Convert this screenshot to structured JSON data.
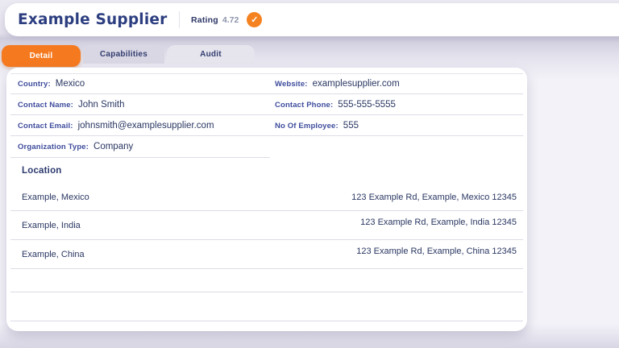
{
  "header": {
    "title": "Example Supplier",
    "rating_label": "Rating",
    "rating_value": "4.72",
    "badge_icon": "check",
    "accent_color": "#f58220"
  },
  "tabs": [
    {
      "label": "Detail",
      "active": true
    },
    {
      "label": "Capabilities",
      "active": false
    },
    {
      "label": "Audit",
      "active": false
    }
  ],
  "detail": {
    "fields": [
      {
        "label": "Country:",
        "value": "Mexico"
      },
      {
        "label": "Website:",
        "value": "examplesupplier.com"
      },
      {
        "label": "Contact Name:",
        "value": "John Smith"
      },
      {
        "label": "Contact Phone:",
        "value": "555-555-5555"
      },
      {
        "label": "Contact Email:",
        "value": "johnsmith@examplesupplier.com"
      },
      {
        "label": "No Of Employee:",
        "value": "555"
      },
      {
        "label": "Organization Type:",
        "value": "Company"
      }
    ],
    "location": {
      "heading": "Location",
      "rows": [
        {
          "name": "Example, Mexico",
          "address": "123 Example Rd, Example, Mexico 12345"
        },
        {
          "name": "Example, India",
          "address": "123 Example Rd, Example, India 12345"
        },
        {
          "name": "Example, China",
          "address": "123 Example Rd, Example, China 12345"
        }
      ]
    }
  },
  "colors": {
    "tab_active_bg": "#f5791f",
    "badge_bg": "#f58220",
    "label_text": "#3e4c9d",
    "value_text": "#2a3762",
    "title_text": "#2c3e80"
  }
}
